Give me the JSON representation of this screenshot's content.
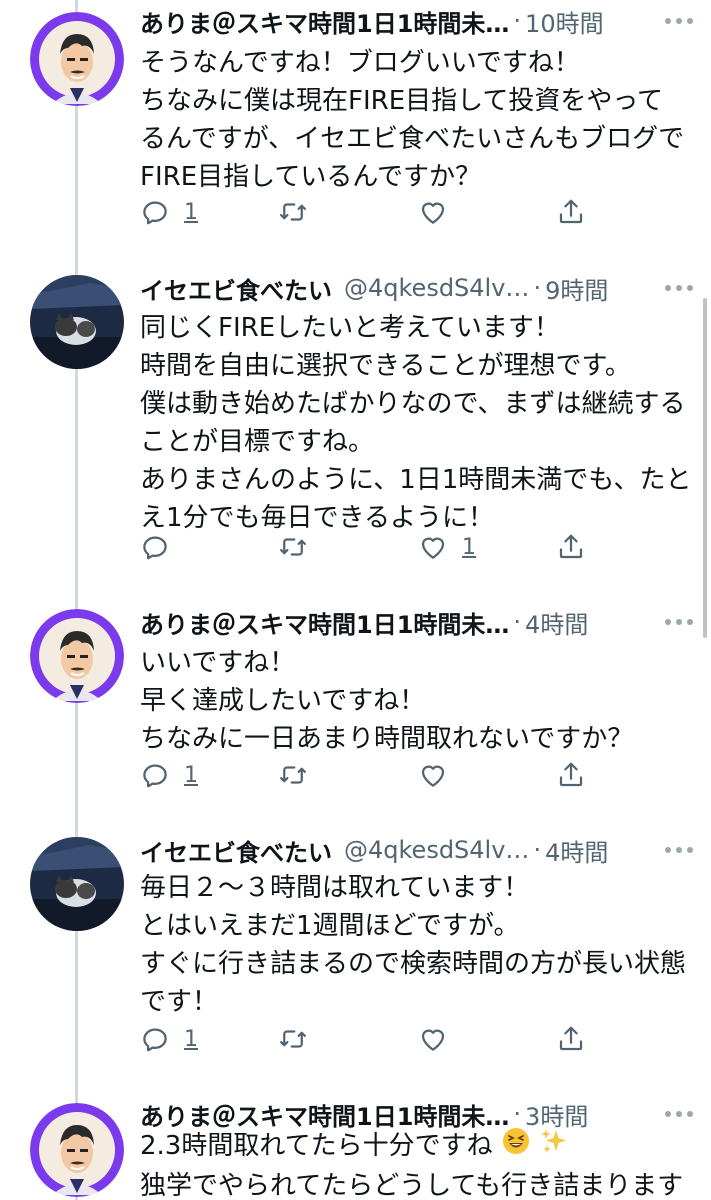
{
  "tweets": [
    {
      "name": "ありま＠スキマ時間1日1時間未…",
      "handle": "",
      "time": "10時間",
      "lines": [
        "そうなんですね！ブログいいですね！",
        "ちなみに僕は現在FIRE目指して投資をやって",
        "るんですが、イセエビ食べたいさんもブログで",
        "FIRE目指しているんですか？"
      ],
      "reply_count": "1",
      "like_count": ""
    },
    {
      "name": "イセエビ食べたい",
      "handle": "@4qkesdS4lv…",
      "time": "9時間",
      "lines": [
        "同じくFIREしたいと考えています！",
        "時間を自由に選択できることが理想です。",
        "僕は動き始めたばかりなので、まずは継続する",
        "ことが目標ですね。",
        "ありまさんのように、1日1時間未満でも、たと",
        "え1分でも毎日できるように！"
      ],
      "reply_count": "",
      "like_count": "1"
    },
    {
      "name": "ありま＠スキマ時間1日1時間未…",
      "handle": "",
      "time": "4時間",
      "lines": [
        "いいですね！",
        "早く達成したいですね！",
        "ちなみに一日あまり時間取れないですか？"
      ],
      "reply_count": "1",
      "like_count": ""
    },
    {
      "name": "イセエビ食べたい",
      "handle": "@4qkesdS4lv…",
      "time": "4時間",
      "lines": [
        "毎日２〜３時間は取れています！",
        "とはいえまだ1週間ほどですが。",
        "すぐに行き詰まるので検索時間の方が長い状態",
        "です！"
      ],
      "reply_count": "1",
      "like_count": ""
    },
    {
      "name": "ありま＠スキマ時間1日1時間未…",
      "handle": "",
      "time": "3時間",
      "lines": [
        "2.3時間取れてたら十分ですね",
        "独学でやられてたらどうしても行き詰まります"
      ],
      "reply_count": "",
      "like_count": ""
    }
  ],
  "colors": {
    "text": "#0f1419",
    "secondary": "#536471",
    "thread_line": "#cfd9de",
    "avatar_purple": "#7c3aed"
  },
  "icons": [
    "reply-icon",
    "retweet-icon",
    "like-icon",
    "share-icon",
    "more-icon",
    "grinning-squinting-face-emoji",
    "sparkles-emoji"
  ]
}
